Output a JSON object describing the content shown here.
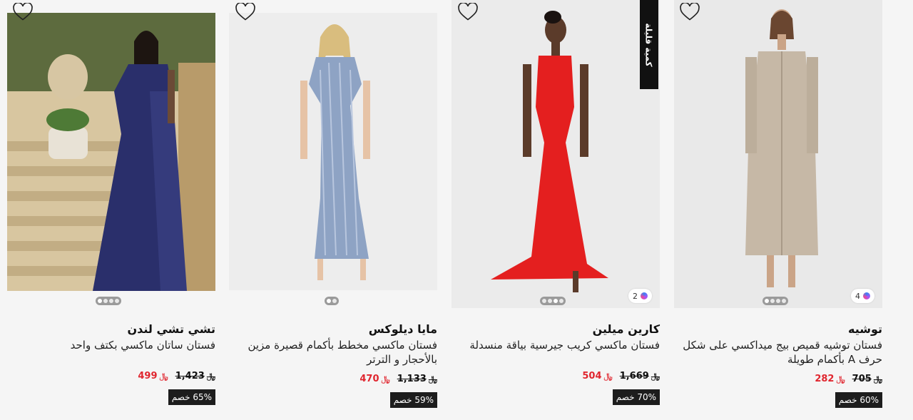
{
  "products": [
    {
      "brand": "توشيه",
      "title": "فستان توشيه قميص بيج ميداكسي على شكل حرف A بأكمام طويلة",
      "old_price": "705",
      "new_price": "282",
      "currency": "﷼",
      "discount": "60% خصم",
      "color_count": "4",
      "wishlist_icon": "heart-outline-icon",
      "image_desc": "beige-shirt-dress"
    },
    {
      "brand": "كارين ميلين",
      "title": "فستان ماكسي كريب جيرسية بياقة منسدلة",
      "old_price": "1,669",
      "new_price": "504",
      "currency": "﷼",
      "discount": "70% خصم",
      "color_count": "2",
      "badge": "كمية قليلة",
      "wishlist_icon": "heart-outline-icon",
      "image_desc": "red-halter-gown"
    },
    {
      "brand": "مايا ديلوكس",
      "title": "فستان ماكسي مخطط بأكمام قصيرة مزين بالأحجار و الترتر",
      "old_price": "1,133",
      "new_price": "470",
      "currency": "﷼",
      "discount": "59% خصم",
      "wishlist_icon": "heart-outline-icon",
      "image_desc": "blue-sequin-gown"
    },
    {
      "brand": "تشي تشي لندن",
      "title": "فستان ساتان ماكسي بكتف واحد",
      "old_price": "1,423",
      "new_price": "499",
      "currency": "﷼",
      "discount": "65% خصم",
      "wishlist_icon": "heart-outline-icon",
      "image_desc": "navy-one-shoulder-satin-gown"
    }
  ],
  "colors": {
    "sale_red": "#e0262f",
    "badge_dark": "#1d1d1d"
  }
}
